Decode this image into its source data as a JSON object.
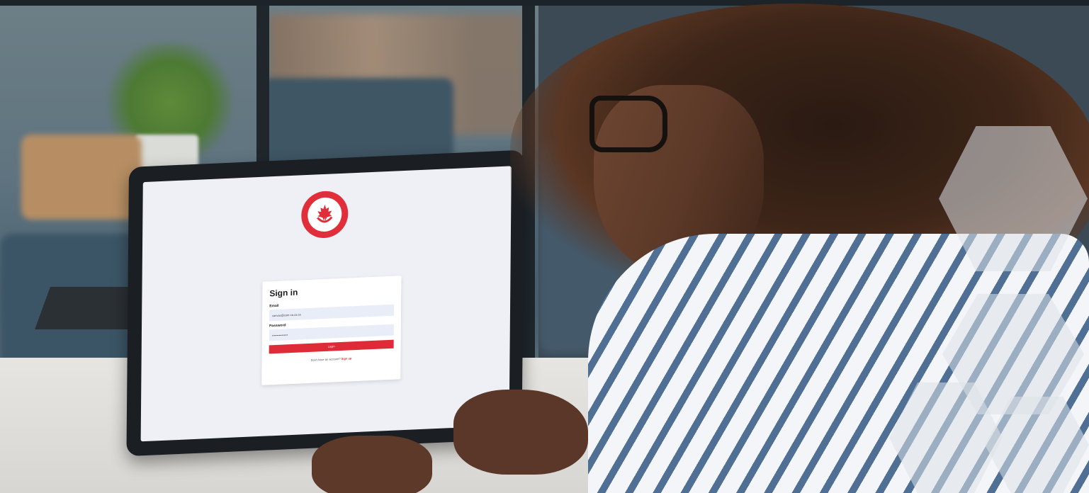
{
  "login_screen": {
    "title": "Sign in",
    "email_label": "Email",
    "email_value": "canvas@com-ca.co.ca",
    "password_label": "Password",
    "password_value": "••••••••••••••••",
    "login_button": "Login",
    "signup_prompt": "Don't have an account?",
    "signup_link": "Sign up"
  },
  "colors": {
    "brand_red": "#df2b37",
    "input_bg": "#e8edf8",
    "screen_bg": "#eef0f6"
  },
  "icons": {
    "logo": "maple-leaf-seal-icon"
  }
}
